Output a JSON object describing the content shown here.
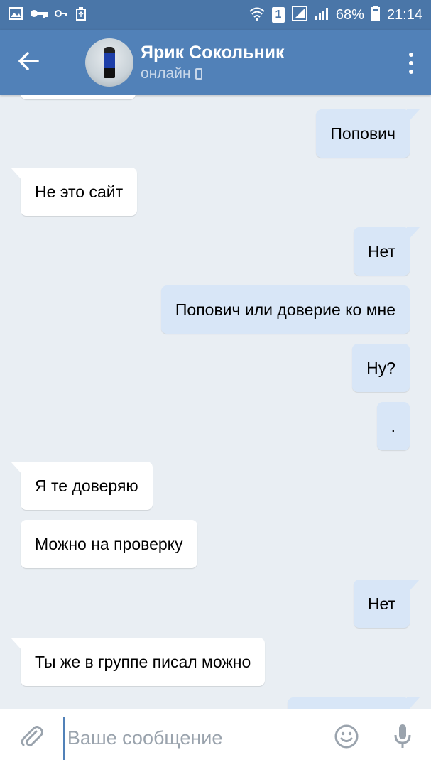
{
  "status_bar": {
    "left_icons": [
      "image-icon",
      "key-icon",
      "key-small-icon",
      "recycle-icon"
    ],
    "right_icons": [
      "wifi-icon",
      "sim-icon",
      "signal-icon",
      "battery-icon"
    ],
    "sim_label": "1",
    "battery": "68%",
    "time": "21:14"
  },
  "header": {
    "contact_name": "Ярик Сокольник",
    "contact_status": "онлайн",
    "accent_color": "#5181b8"
  },
  "messages": [
    {
      "direction": "out",
      "text": "Попович",
      "tail": true
    },
    {
      "direction": "in",
      "text": "Не это сайт",
      "tail": true
    },
    {
      "direction": "out",
      "text": "Нет",
      "tail": true
    },
    {
      "direction": "out",
      "text": "Попович или доверие ко мне",
      "tail": false
    },
    {
      "direction": "out",
      "text": "Ну?",
      "tail": false
    },
    {
      "direction": "out",
      "text": ".",
      "tail": false
    },
    {
      "direction": "in",
      "text": "Я те доверяю",
      "tail": true
    },
    {
      "direction": "in",
      "text": "Можно на проверку",
      "tail": false
    },
    {
      "direction": "out",
      "text": "Нет",
      "tail": true
    },
    {
      "direction": "in",
      "text": "Ты же в группе писал можно",
      "tail": true
    }
  ],
  "input": {
    "placeholder": "Ваше сообщение",
    "value": ""
  },
  "colors": {
    "incoming_bubble": "#ffffff",
    "outgoing_bubble": "#d8e6f7",
    "background": "#e9eef3"
  }
}
